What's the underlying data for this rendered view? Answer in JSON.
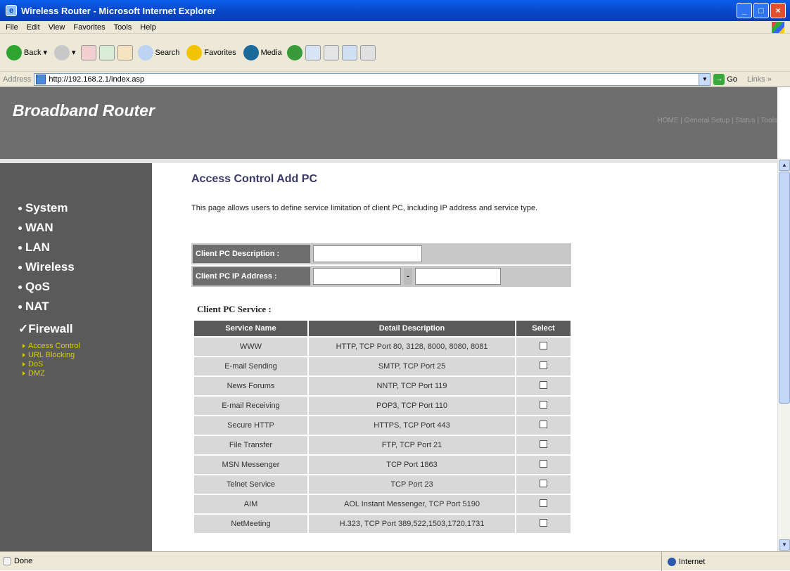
{
  "window": {
    "title": "Wireless Router - Microsoft Internet Explorer"
  },
  "menu": [
    "File",
    "Edit",
    "View",
    "Favorites",
    "Tools",
    "Help"
  ],
  "toolbar": {
    "back": "Back",
    "search": "Search",
    "favorites": "Favorites",
    "media": "Media"
  },
  "address": {
    "label": "Address",
    "url": "http://192.168.2.1/index.asp",
    "go": "Go",
    "links": "Links »"
  },
  "banner": {
    "brand": "Broadband Router",
    "topnav": "HOME | General Setup | Status | Tools"
  },
  "sidebar": {
    "items": [
      "System",
      "WAN",
      "LAN",
      "Wireless",
      "QoS",
      "NAT",
      "Firewall"
    ],
    "active": "Firewall",
    "subitems": [
      "Access Control",
      "URL Blocking",
      "DoS",
      "DMZ"
    ]
  },
  "content": {
    "title": "Access Control Add PC",
    "description": "This page allows users to define service limitation of client PC, including IP address and service type.",
    "form": {
      "desc_label": "Client PC Description :",
      "ip_label": "Client PC IP Address :",
      "dash": "-"
    },
    "service_label": "Client PC Service :",
    "table_headers": [
      "Service Name",
      "Detail Description",
      "Select"
    ],
    "services": [
      {
        "name": "WWW",
        "detail": "HTTP, TCP Port 80, 3128, 8000, 8080, 8081"
      },
      {
        "name": "E-mail Sending",
        "detail": "SMTP, TCP Port 25"
      },
      {
        "name": "News Forums",
        "detail": "NNTP, TCP Port 119"
      },
      {
        "name": "E-mail Receiving",
        "detail": "POP3, TCP Port 110"
      },
      {
        "name": "Secure HTTP",
        "detail": "HTTPS, TCP Port 443"
      },
      {
        "name": "File Transfer",
        "detail": "FTP, TCP Port 21"
      },
      {
        "name": "MSN Messenger",
        "detail": "TCP Port 1863"
      },
      {
        "name": "Telnet Service",
        "detail": "TCP Port 23"
      },
      {
        "name": "AIM",
        "detail": "AOL Instant Messenger, TCP Port 5190"
      },
      {
        "name": "NetMeeting",
        "detail": "H.323, TCP Port 389,522,1503,1720,1731"
      }
    ]
  },
  "status": {
    "left": "Done",
    "zone": "Internet"
  }
}
